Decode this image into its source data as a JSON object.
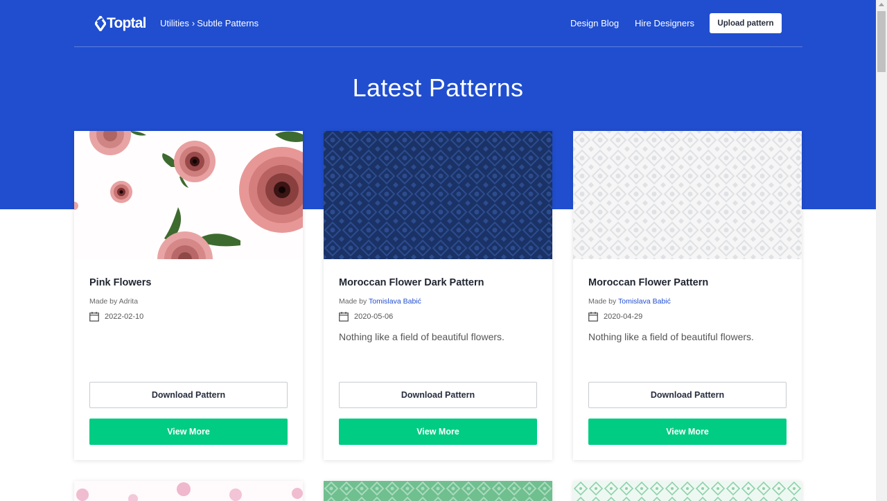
{
  "header": {
    "logo_text": "Toptal",
    "breadcrumb": {
      "parent": "Utilities",
      "separator": "›",
      "current": "Subtle Patterns"
    },
    "nav": {
      "design_blog": "Design Blog",
      "hire_designers": "Hire Designers",
      "upload": "Upload pattern"
    }
  },
  "page_title": "Latest Patterns",
  "cards": [
    {
      "title": "Pink Flowers",
      "made_by_prefix": "Made by ",
      "author": "Adrita",
      "author_linked": false,
      "date": "2022-02-10",
      "description": "",
      "download_label": "Download Pattern",
      "view_label": "View More",
      "pattern": "pink-flowers"
    },
    {
      "title": "Moroccan Flower Dark Pattern",
      "made_by_prefix": "Made by ",
      "author": "Tomislava Babić",
      "author_linked": true,
      "date": "2020-05-06",
      "description": "Nothing like a field of beautiful flowers.",
      "download_label": "Download Pattern",
      "view_label": "View More",
      "pattern": "moroccan-dark"
    },
    {
      "title": "Moroccan Flower Pattern",
      "made_by_prefix": "Made by ",
      "author": "Tomislava Babić",
      "author_linked": true,
      "date": "2020-04-29",
      "description": "Nothing like a field of beautiful flowers.",
      "download_label": "Download Pattern",
      "view_label": "View More",
      "pattern": "moroccan-light"
    }
  ],
  "colors": {
    "brand_blue": "#204ecf",
    "accent_green": "#00cc83",
    "link_blue": "#204ecf"
  },
  "icons": {
    "date": "calendar-icon",
    "breadcrumb_separator": "chevron-right-icon",
    "logo": "toptal-logo-icon"
  }
}
